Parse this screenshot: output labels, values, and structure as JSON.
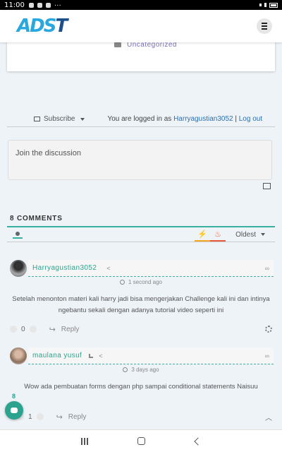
{
  "status": {
    "time": "11:00",
    "more": "···"
  },
  "header": {
    "logo_a": "ADS",
    "logo_t": "T"
  },
  "post": {
    "category": "Uncategorized"
  },
  "subscribe": {
    "label": "Subscribe",
    "logged_prefix": "You are logged in as",
    "username": "Harryagustian3052",
    "separator": "|",
    "logout": "Log out"
  },
  "editor": {
    "placeholder": "Join the discussion"
  },
  "comments_header": {
    "count_label": "8 COMMENTS",
    "sort_label": "Oldest"
  },
  "comments": [
    {
      "author": "Harryagustian3052",
      "time": "1 second ago",
      "text": "Setelah menonton materi kali harry jadi bisa mengerjakan Challenge kali ini dan intinya ngebantu sekali dengan adanya tutorial video seperti ini",
      "votes": "0",
      "reply_label": "Reply"
    },
    {
      "author": "maulana yusuf",
      "time": "3 days ago",
      "text": "Wow ada pembuatan forms dengan php sampai conditional statements Naisuu",
      "votes": "1",
      "reply_label": "Reply"
    }
  ],
  "floating": {
    "badge": "8"
  },
  "colors": {
    "accent": "#2aa38f",
    "link": "#2a6fb0",
    "category": "#7a6fb8",
    "bolt": "#f5a623",
    "fire": "#e85b3b"
  },
  "icons": [
    "folder-icon",
    "mail-icon",
    "image-icon",
    "user-filter-icon",
    "bolt-icon",
    "fire-icon",
    "share-icon",
    "rss-icon",
    "link-icon",
    "clock-icon",
    "reply-icon",
    "gear-icon",
    "chevron-up-icon",
    "chat-icon"
  ]
}
